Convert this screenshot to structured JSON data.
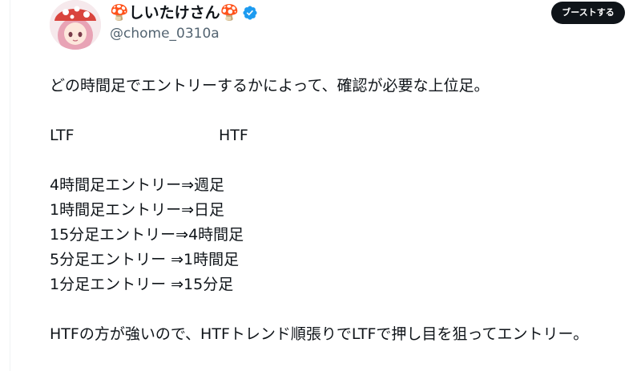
{
  "author": {
    "display_name": "🍄しいたけさん🍄",
    "handle": "@chome_0310a"
  },
  "actions": {
    "boost_label": "ブーストする"
  },
  "tweet": {
    "line1": "どの時間足でエントリーするかによって、確認が必要な上位足。",
    "ltf": "LTF",
    "htf": "HTF",
    "mappings": [
      "4時間足エントリー⇒週足",
      "1時間足エントリー⇒日足",
      "15分足エントリー⇒4時間足",
      "5分足エントリー ⇒1時間足",
      "1分足エントリー ⇒15分足"
    ],
    "conclusion": "HTFの方が強いので、HTFトレンド順張りでLTFで押し目を狙ってエントリー。"
  },
  "colors": {
    "text": "#0f1419",
    "secondary": "#536471",
    "verified": "#1d9bf0",
    "button_bg": "#0f1419"
  },
  "icons": [
    "avatar-image",
    "verified-badge-icon"
  ]
}
